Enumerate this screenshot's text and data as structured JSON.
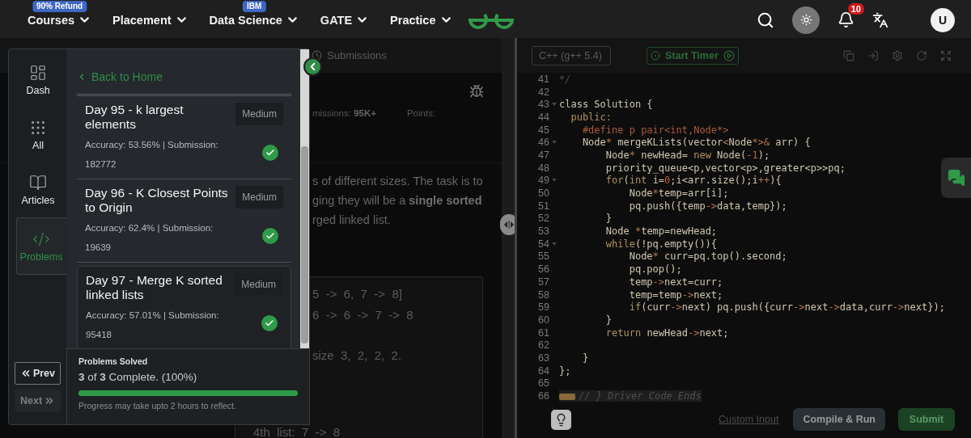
{
  "nav": {
    "items": [
      {
        "label": "Courses",
        "badge": "90% Refund"
      },
      {
        "label": "Placement"
      },
      {
        "label": "Data Science",
        "badge": "IBM"
      },
      {
        "label": "GATE"
      },
      {
        "label": "Practice"
      }
    ],
    "notifications": "10",
    "avatar": "U"
  },
  "problem_pane": {
    "tab": "Submissions",
    "meta": [
      "missions: **95K+**",
      "Points:"
    ],
    "description": [
      "s of different sizes. The task is to",
      "ging they will be a **single sorted**",
      "rged linked list."
    ],
    "example": [
      [
        "5  ->  6,  7  ->  8]",
        "6  ->  6  ->  7  ->  8"
      ],
      [
        "size  3,  2,  2,  2."
      ]
    ],
    "last_line": "4th  list:  7  ->  8"
  },
  "sidebar": {
    "rail": [
      {
        "label": "Dash",
        "selected": false
      },
      {
        "label": "All",
        "selected": false
      },
      {
        "label": "Articles",
        "selected": false
      },
      {
        "label": "Problems",
        "selected": true
      }
    ],
    "prev": {
      "label": "Prev",
      "disabled": false
    },
    "next": {
      "label": "Next",
      "disabled": true
    },
    "back": "Back to Home",
    "problems": [
      {
        "title": "Day 95 - k largest elements",
        "difficulty": "Medium",
        "stats": "Accuracy: 53.56% | Submission: 182772",
        "solved": true,
        "selected": false
      },
      {
        "title": "Day 96 - K Closest Points to Origin",
        "difficulty": "Medium",
        "stats": "Accuracy: 62.4% | Submission: 19639",
        "solved": true,
        "selected": false
      },
      {
        "title": "Day 97 - Merge K sorted linked lists",
        "difficulty": "Medium",
        "stats": "Accuracy: 57.01% | Submission: 95418",
        "solved": true,
        "selected": true
      }
    ],
    "progress": {
      "heading": "Problems Solved",
      "summary": "**3** of **3** Complete. (100%)",
      "level": 1,
      "note": "Progress may take upto 2 hours to reflect."
    }
  },
  "editor": {
    "language": "C++ (g++ 5.4)",
    "timer": "Start Timer",
    "lines": [
      {
        "number": "41",
        "segments": [
          {
            "kind": "comment",
            "text": "*/"
          }
        ]
      },
      {
        "number": "42"
      },
      {
        "number": "43",
        "foldable": true,
        "segments": [
          {
            "kind": "plain",
            "text": "class Solution {"
          }
        ]
      },
      {
        "number": "44",
        "segments": [
          {
            "kind": "keyword",
            "text": "  public:"
          }
        ]
      },
      {
        "number": "45",
        "segments": [
          {
            "kind": "preproc",
            "text": "    #define p pair<int,Node*>"
          }
        ]
      },
      {
        "number": "46",
        "foldable": true,
        "segments": [
          {
            "kind": "plain",
            "text": "    Node"
          },
          {
            "kind": "op",
            "text": "*"
          },
          {
            "kind": "plain",
            "text": " mergeKLists(vector"
          },
          {
            "kind": "op",
            "text": "<"
          },
          {
            "kind": "plain",
            "text": "Node"
          },
          {
            "kind": "op",
            "text": "*>&"
          },
          {
            "kind": "plain",
            "text": " arr) {"
          }
        ]
      },
      {
        "number": "47",
        "segments": [
          {
            "kind": "plain",
            "text": "        Node"
          },
          {
            "kind": "op",
            "text": "*"
          },
          {
            "kind": "plain",
            "text": " newHead= "
          },
          {
            "kind": "keyword",
            "text": "new"
          },
          {
            "kind": "plain",
            "text": " Node("
          },
          {
            "kind": "number",
            "text": "-1"
          },
          {
            "kind": "plain",
            "text": ");"
          }
        ]
      },
      {
        "number": "48",
        "segments": [
          {
            "kind": "plain",
            "text": "        priority_queue<p,vector<p>,greater<p>>pq;"
          }
        ]
      },
      {
        "number": "49",
        "foldable": true,
        "segments": [
          {
            "kind": "keyword",
            "text": "        for"
          },
          {
            "kind": "plain",
            "text": "("
          },
          {
            "kind": "keyword",
            "text": "int"
          },
          {
            "kind": "plain",
            "text": " i="
          },
          {
            "kind": "number",
            "text": "0"
          },
          {
            "kind": "plain",
            "text": ";i<arr.size();i"
          },
          {
            "kind": "op",
            "text": "++"
          },
          {
            "kind": "plain",
            "text": "){"
          }
        ]
      },
      {
        "number": "50",
        "segments": [
          {
            "kind": "plain",
            "text": "            Node"
          },
          {
            "kind": "op",
            "text": "*"
          },
          {
            "kind": "plain",
            "text": "temp=arr[i];"
          }
        ]
      },
      {
        "number": "51",
        "segments": [
          {
            "kind": "plain",
            "text": "            pq.push({temp"
          },
          {
            "kind": "op",
            "text": "->"
          },
          {
            "kind": "plain",
            "text": "data,temp});"
          }
        ]
      },
      {
        "number": "52",
        "segments": [
          {
            "kind": "plain",
            "text": "        }"
          }
        ]
      },
      {
        "number": "53",
        "segments": [
          {
            "kind": "plain",
            "text": "        Node "
          },
          {
            "kind": "op",
            "text": "*"
          },
          {
            "kind": "plain",
            "text": "temp=newHead;"
          }
        ]
      },
      {
        "number": "54",
        "foldable": true,
        "segments": [
          {
            "kind": "keyword",
            "text": "        while"
          },
          {
            "kind": "plain",
            "text": "(!pq.empty()){"
          }
        ]
      },
      {
        "number": "55",
        "segments": [
          {
            "kind": "plain",
            "text": "            Node"
          },
          {
            "kind": "op",
            "text": "*"
          },
          {
            "kind": "plain",
            "text": " curr=pq.top().second;"
          }
        ]
      },
      {
        "number": "56",
        "segments": [
          {
            "kind": "plain",
            "text": "            pq.pop();"
          }
        ]
      },
      {
        "number": "57",
        "segments": [
          {
            "kind": "plain",
            "text": "            temp"
          },
          {
            "kind": "op",
            "text": "->"
          },
          {
            "kind": "plain",
            "text": "next=curr;"
          }
        ]
      },
      {
        "number": "58",
        "segments": [
          {
            "kind": "plain",
            "text": "            temp=temp"
          },
          {
            "kind": "op",
            "text": "->"
          },
          {
            "kind": "plain",
            "text": "next;"
          }
        ]
      },
      {
        "number": "59",
        "segments": [
          {
            "kind": "keyword",
            "text": "            if"
          },
          {
            "kind": "plain",
            "text": "(curr"
          },
          {
            "kind": "op",
            "text": "->"
          },
          {
            "kind": "plain",
            "text": "next) pq.push({curr"
          },
          {
            "kind": "op",
            "text": "->"
          },
          {
            "kind": "plain",
            "text": "next"
          },
          {
            "kind": "op",
            "text": "->"
          },
          {
            "kind": "plain",
            "text": "data,curr"
          },
          {
            "kind": "op",
            "text": "->"
          },
          {
            "kind": "plain",
            "text": "next});"
          }
        ]
      },
      {
        "number": "60",
        "segments": [
          {
            "kind": "plain",
            "text": "        }"
          }
        ]
      },
      {
        "number": "61",
        "segments": [
          {
            "kind": "keyword",
            "text": "        return"
          },
          {
            "kind": "plain",
            "text": " newHead"
          },
          {
            "kind": "op",
            "text": "->"
          },
          {
            "kind": "plain",
            "text": "next;"
          }
        ]
      },
      {
        "number": "62"
      },
      {
        "number": "63",
        "segments": [
          {
            "kind": "plain",
            "text": "    }"
          }
        ]
      },
      {
        "number": "64",
        "segments": [
          {
            "kind": "plain",
            "text": "};"
          }
        ]
      },
      {
        "number": "65"
      },
      {
        "number": "66",
        "folded": true,
        "segments": [
          {
            "kind": "comment",
            "text": "// } Driver Code Ends"
          }
        ]
      }
    ],
    "custom_input": "Custom Input",
    "compile": "Compile & Run",
    "submit": "Submit"
  }
}
